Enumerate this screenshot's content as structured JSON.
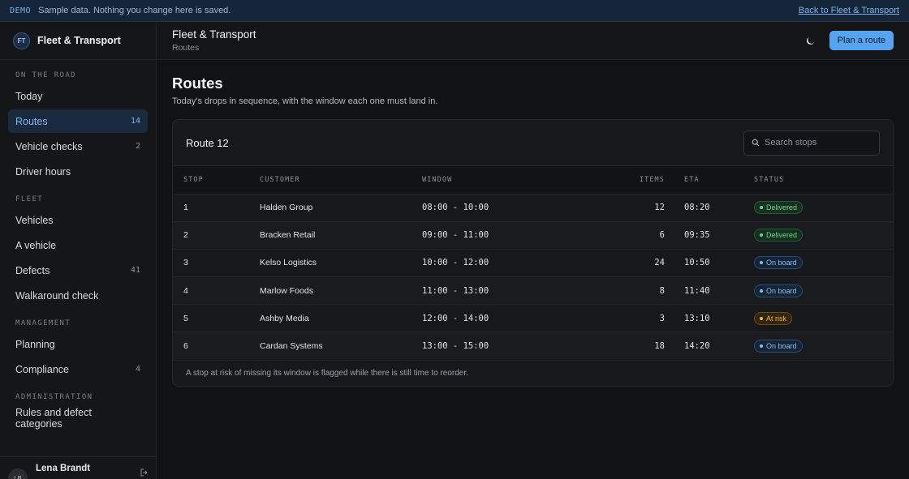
{
  "banner": {
    "tag": "DEMO",
    "message": "Sample data. Nothing you change here is saved.",
    "back_link": "Back to Fleet & Transport"
  },
  "brand": {
    "initials": "FT",
    "name": "Fleet & Transport"
  },
  "sidebar": {
    "sections": [
      {
        "title": "ON THE ROAD",
        "items": [
          {
            "label": "Today",
            "count": ""
          },
          {
            "label": "Routes",
            "count": "14",
            "active": true
          },
          {
            "label": "Vehicle checks",
            "count": "2"
          },
          {
            "label": "Driver hours",
            "count": ""
          }
        ]
      },
      {
        "title": "FLEET",
        "items": [
          {
            "label": "Vehicles",
            "count": ""
          },
          {
            "label": "A vehicle",
            "count": ""
          },
          {
            "label": "Defects",
            "count": "41"
          },
          {
            "label": "Walkaround check",
            "count": ""
          }
        ]
      },
      {
        "title": "MANAGEMENT",
        "items": [
          {
            "label": "Planning",
            "count": ""
          },
          {
            "label": "Compliance",
            "count": "4"
          }
        ]
      },
      {
        "title": "ADMINISTRATION",
        "items": [
          {
            "label": "Rules and defect categories",
            "count": ""
          }
        ]
      }
    ]
  },
  "user": {
    "initials": "LB",
    "name": "Lena Brandt"
  },
  "topbar": {
    "app_title": "Fleet & Transport",
    "breadcrumb": "Routes",
    "theme_icon": "moon-icon",
    "primary_button": "Plan a route"
  },
  "page": {
    "title": "Routes",
    "subtitle": "Today's drops in sequence, with the window each one must land in."
  },
  "route": {
    "title": "Route 12",
    "search_placeholder": "Search stops",
    "columns": [
      "STOP",
      "CUSTOMER",
      "WINDOW",
      "ITEMS",
      "ETA",
      "STATUS"
    ],
    "rows": [
      {
        "stop": "1",
        "customer": "Halden Group",
        "window": "08:00 - 10:00",
        "items": "12",
        "eta": "08:20",
        "status": "Delivered",
        "status_kind": "delivered"
      },
      {
        "stop": "2",
        "customer": "Bracken Retail",
        "window": "09:00 - 11:00",
        "items": "6",
        "eta": "09:35",
        "status": "Delivered",
        "status_kind": "delivered"
      },
      {
        "stop": "3",
        "customer": "Kelso Logistics",
        "window": "10:00 - 12:00",
        "items": "24",
        "eta": "10:50",
        "status": "On board",
        "status_kind": "onboard"
      },
      {
        "stop": "4",
        "customer": "Marlow Foods",
        "window": "11:00 - 13:00",
        "items": "8",
        "eta": "11:40",
        "status": "On board",
        "status_kind": "onboard"
      },
      {
        "stop": "5",
        "customer": "Ashby Media",
        "window": "12:00 - 14:00",
        "items": "3",
        "eta": "13:10",
        "status": "At risk",
        "status_kind": "risk"
      },
      {
        "stop": "6",
        "customer": "Cardan Systems",
        "window": "13:00 - 15:00",
        "items": "18",
        "eta": "14:20",
        "status": "On board",
        "status_kind": "onboard"
      }
    ],
    "footer_note": "A stop at risk of missing its window is flagged while there is still time to reorder."
  },
  "colors": {
    "accent": "#56a4f0",
    "delivered": "#6fd18e",
    "onboard": "#8cbdf0",
    "risk": "#efb54e"
  }
}
